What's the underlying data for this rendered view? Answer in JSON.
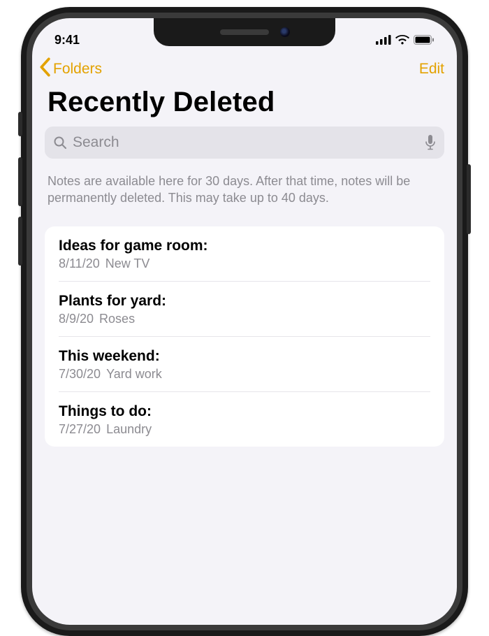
{
  "statusBar": {
    "time": "9:41"
  },
  "nav": {
    "back": "Folders",
    "edit": "Edit"
  },
  "title": "Recently Deleted",
  "search": {
    "placeholder": "Search"
  },
  "info": "Notes are available here for 30 days. After that time, notes will be permanently deleted. This may take up to 40 days.",
  "notes": [
    {
      "title": "Ideas for game room:",
      "date": "8/11/20",
      "preview": "New TV"
    },
    {
      "title": "Plants for yard:",
      "date": "8/9/20",
      "preview": "Roses"
    },
    {
      "title": "This weekend:",
      "date": "7/30/20",
      "preview": "Yard work"
    },
    {
      "title": "Things to do:",
      "date": "7/27/20",
      "preview": "Laundry"
    }
  ]
}
